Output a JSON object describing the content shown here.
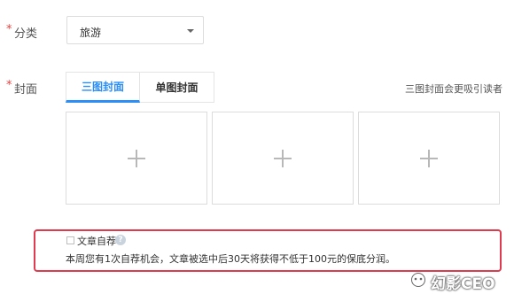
{
  "form": {
    "category": {
      "required_mark": "*",
      "label": "分类",
      "selected_value": "旅游"
    },
    "cover": {
      "required_mark": "*",
      "label": "封面",
      "tabs": [
        {
          "label": "三图封面",
          "active": true
        },
        {
          "label": "单图封面",
          "active": false
        }
      ],
      "hint": "三图封面会更吸引读者",
      "slots": [
        "+",
        "+",
        "+"
      ]
    },
    "self_recommend": {
      "checkbox_label": "文章自荐",
      "checked": false,
      "help_icon": "?",
      "description": "本周您有1次自荐机会，文章被选中后30天将获得不低于100元的保底分润。"
    }
  },
  "watermark": {
    "text": "幻影CEO"
  },
  "colors": {
    "accent": "#2b8ff7",
    "required": "#e64340",
    "highlight_border": "#e03a4f"
  }
}
